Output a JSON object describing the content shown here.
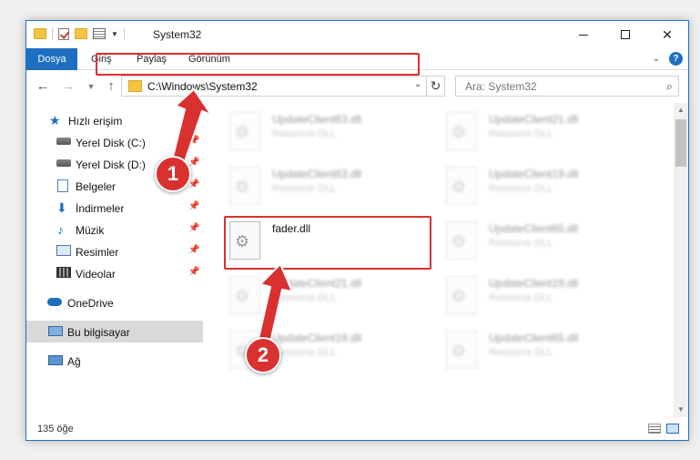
{
  "window": {
    "title": "System32",
    "ribbon_tabs": [
      "Dosya",
      "Giriş",
      "Paylaş",
      "Görünüm"
    ]
  },
  "address": {
    "path": "C:\\Windows\\System32"
  },
  "search": {
    "placeholder": "Ara: System32"
  },
  "sidebar": {
    "items": [
      {
        "label": "Hızlı erişim",
        "icon": "star-icon"
      },
      {
        "label": "Yerel Disk (C:)",
        "icon": "disk-icon",
        "pinned": true
      },
      {
        "label": "Yerel Disk (D:)",
        "icon": "disk-icon",
        "pinned": true
      },
      {
        "label": "Belgeler",
        "icon": "documents-icon",
        "pinned": true
      },
      {
        "label": "İndirmeler",
        "icon": "download-icon",
        "pinned": true
      },
      {
        "label": "Müzik",
        "icon": "music-icon",
        "pinned": true
      },
      {
        "label": "Resimler",
        "icon": "pictures-icon",
        "pinned": true
      },
      {
        "label": "Videolar",
        "icon": "videos-icon",
        "pinned": true
      },
      {
        "label": "OneDrive",
        "icon": "cloud-icon"
      },
      {
        "label": "Bu bilgisayar",
        "icon": "computer-icon",
        "selected": true
      },
      {
        "label": "Ağ",
        "icon": "network-icon"
      }
    ]
  },
  "files": {
    "left": [
      {
        "name": "UpdateClient63.dll",
        "desc": "Resource DLL"
      },
      {
        "name": "UpdateClient63.dll",
        "desc": "Resource DLL"
      },
      {
        "name": "fader.dll",
        "desc": ""
      },
      {
        "name": "UpdateClient21.dll",
        "desc": "Resource DLL"
      },
      {
        "name": "UpdateClient19.dll",
        "desc": "Resource DLL"
      }
    ],
    "right": [
      {
        "name": "UpdateClient21.dll",
        "desc": "Resource DLL"
      },
      {
        "name": "UpdateClient19.dll",
        "desc": "Resource DLL"
      },
      {
        "name": "UpdateClient65.dll",
        "desc": "Resource DLL"
      },
      {
        "name": "UpdateClient19.dll",
        "desc": "Resource DLL"
      },
      {
        "name": "UpdateClient65.dll",
        "desc": "Resource DLL"
      }
    ]
  },
  "status": {
    "count": "135 öğe"
  },
  "annotations": {
    "step1": "1",
    "step2": "2",
    "color": "#d9312f"
  }
}
